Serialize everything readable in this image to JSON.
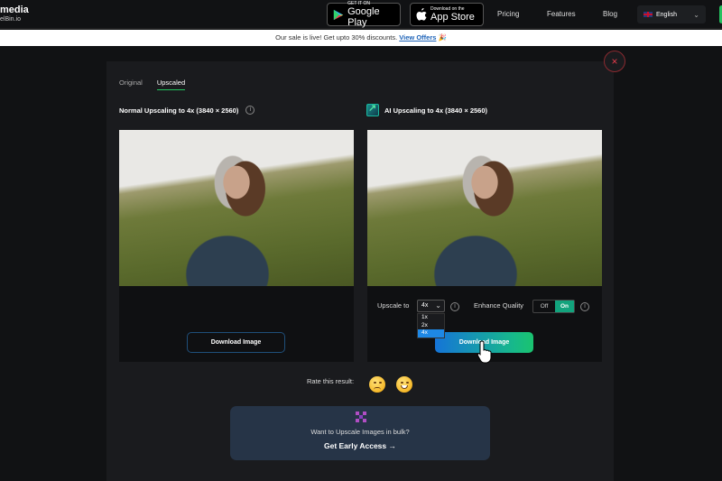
{
  "header": {
    "logo_line1": "media",
    "logo_line2": "elBin.io",
    "google_play": {
      "small": "GET IT ON",
      "big": "Google Play"
    },
    "app_store": {
      "small": "Download on the",
      "big": "App Store"
    },
    "nav": [
      "Pricing",
      "Features",
      "Blog"
    ],
    "language": "English"
  },
  "promo": {
    "text": "Our sale is live! Get upto 30% discounts.",
    "link": "View Offers",
    "emoji": "🎉"
  },
  "modal": {
    "tabs": [
      {
        "label": "Original",
        "active": false
      },
      {
        "label": "Upscaled",
        "active": true
      }
    ],
    "close_icon": "×",
    "normal": {
      "title": "Normal Upscaling to 4x (3840 × 2560)",
      "download_label": "Download Image"
    },
    "ai": {
      "title": "AI Upscaling to 4x (3840 × 2560)",
      "upscale_label": "Upscale to",
      "upscale_value": "4x",
      "upscale_options": [
        "1x",
        "2x",
        "4x"
      ],
      "enhance_label": "Enhance Quality",
      "toggle_off": "Off",
      "toggle_on": "On",
      "enhance_state": "On",
      "download_label": "Download Image"
    },
    "rate_label": "Rate this result:",
    "bulk": {
      "question": "Want to Upscale Images in bulk?",
      "cta": "Get Early Access →"
    }
  }
}
